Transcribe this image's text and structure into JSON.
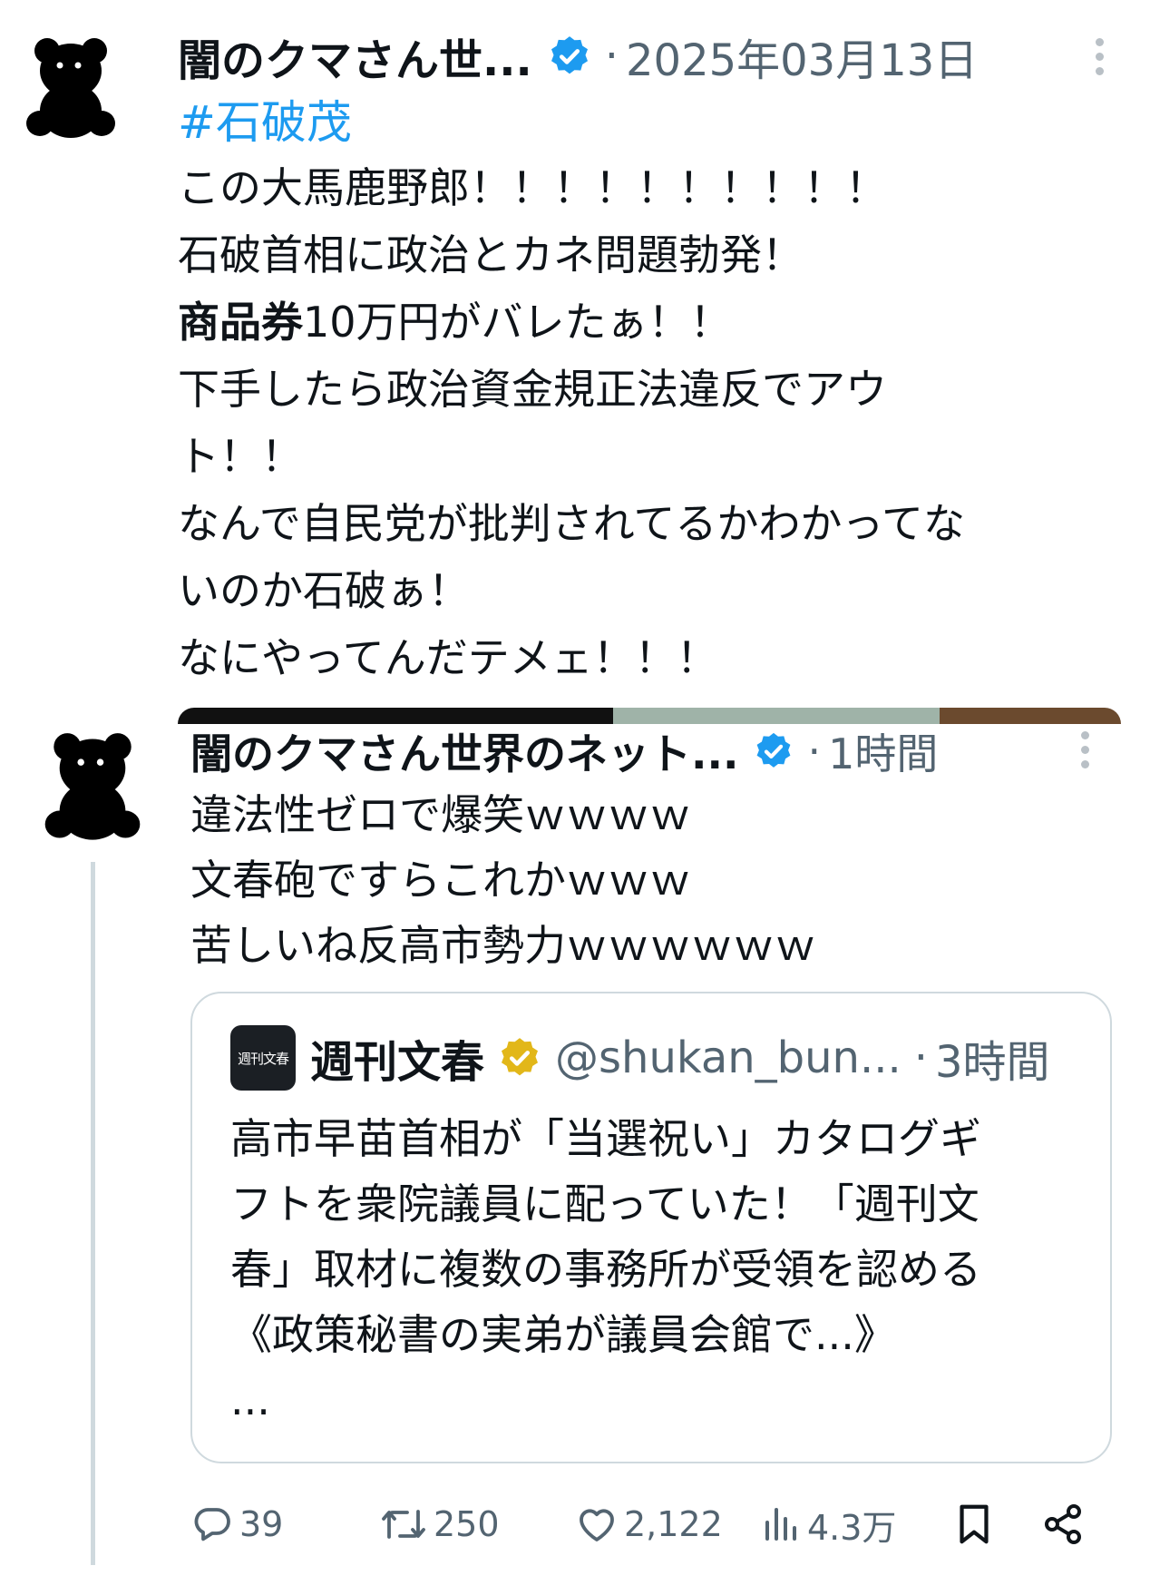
{
  "tweet": {
    "author": "闇のクマさん世...",
    "separator": "·",
    "date": "2025年03月13日",
    "hashtag": "#石破茂",
    "lines": [
      "この大馬鹿野郎！！！！！！！！！！",
      "石破首相に政治とカネ問題勃発！",
      {
        "bold": "商品券",
        "rest": "10万円がバレたぁ！！"
      },
      "下手したら政治資金規正法違反でアウ",
      "ト！！",
      "なんで自民党が批判されてるかわかってな",
      "いのか石破ぁ！",
      "なにやってんだテメェ！！！"
    ]
  },
  "reply": {
    "author": "闇のクマさん世界のネット...",
    "separator": "·",
    "time": "1時間",
    "lines": [
      "違法性ゼロで爆笑ｗｗｗｗ",
      "文春砲ですらこれかｗｗｗ",
      "苦しいね反高市勢力ｗｗｗｗｗｗ"
    ],
    "quote": {
      "avatar_text": "週刊文春",
      "name": "週刊文春",
      "handle": "@shukan_bun...",
      "separator": "·",
      "time": "3時間",
      "lines": [
        "高市早苗首相が「当選祝い」カタログギ",
        "フトを衆院議員に配っていた！「週刊文",
        "春」取材に複数の事務所が受領を認める",
        "《政策秘書の実弟が議員会館で...》",
        "..."
      ]
    },
    "actions": {
      "replies": "39",
      "reposts": "250",
      "likes": "2,122",
      "views": "4.3万"
    }
  },
  "colors": {
    "text": "#0f1419",
    "muted": "#536471",
    "link": "#1d9bf0",
    "verified_blue": "#1d9bf0",
    "verified_gold": "#e2b719",
    "border": "#cfd9de"
  },
  "icons": [
    "bear-avatar-icon",
    "verified-badge-icon",
    "more-icon",
    "gold-verified-icon",
    "reply-icon",
    "repost-icon",
    "like-icon",
    "views-icon",
    "bookmark-icon",
    "share-icon"
  ]
}
